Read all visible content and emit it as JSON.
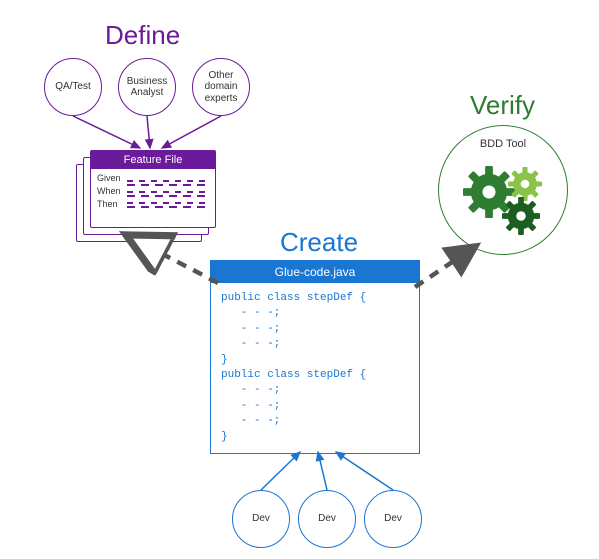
{
  "sections": {
    "define": "Define",
    "create": "Create",
    "verify": "Verify"
  },
  "roles": {
    "qa": "QA/Test",
    "ba": "Business\nAnalyst",
    "exp": "Other\ndomain\nexperts",
    "dev1": "Dev",
    "dev2": "Dev",
    "dev3": "Dev"
  },
  "feature_file": {
    "header": "Feature File",
    "gwt": {
      "given": "Given",
      "when": "When",
      "then": "Then"
    }
  },
  "glue": {
    "header": "Glue-code.java",
    "code": "public class stepDef {\n   - - -;\n   - - -;\n   - - -;\n}\npublic class stepDef {\n   - - -;\n   - - -;\n   - - -;\n}"
  },
  "bdd": {
    "label": "BDD Tool"
  },
  "colors": {
    "purple": "#6a1b9a",
    "blue": "#1976d2",
    "green": "#2e7d32",
    "lightgreen": "#8bc34a",
    "grey": "#555555"
  }
}
